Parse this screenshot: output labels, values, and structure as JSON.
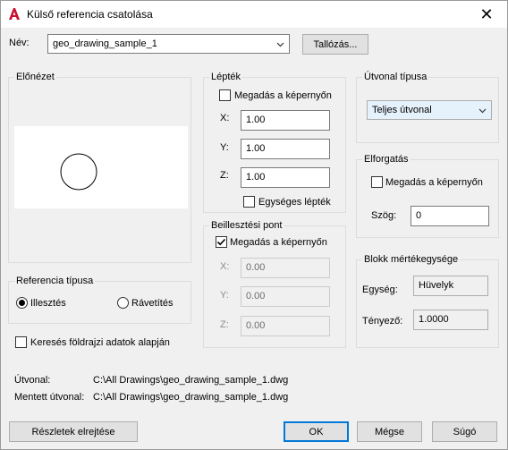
{
  "window": {
    "title": "Külső referencia csatolása",
    "close_symbol": "✕"
  },
  "name_row": {
    "label": "Név:",
    "value": "geo_drawing_sample_1",
    "browse_label": "Tallózás..."
  },
  "preview": {
    "title": "Előnézet"
  },
  "reference_type": {
    "title": "Referencia típusa",
    "options": [
      {
        "label": "Illesztés",
        "selected": true
      },
      {
        "label": "Rávetítés",
        "selected": false
      }
    ]
  },
  "geo_search": {
    "label": "Keresés földrajzi adatok alapján",
    "checked": false
  },
  "scale": {
    "title": "Lépték",
    "on_screen_label": "Megadás a képernyőn",
    "on_screen_checked": false,
    "x_label": "X:",
    "x_value": "1.00",
    "y_label": "Y:",
    "y_value": "1.00",
    "z_label": "Z:",
    "z_value": "1.00",
    "uniform_label": "Egységes lépték",
    "uniform_checked": false
  },
  "insertion": {
    "title": "Beillesztési pont",
    "on_screen_label": "Megadás a képernyőn",
    "on_screen_checked": true,
    "x_label": "X:",
    "x_value": "0.00",
    "y_label": "Y:",
    "y_value": "0.00",
    "z_label": "Z:",
    "z_value": "0.00"
  },
  "path_type": {
    "title": "Útvonal típusa",
    "value": "Teljes útvonal"
  },
  "rotation": {
    "title": "Elforgatás",
    "on_screen_label": "Megadás a képernyőn",
    "on_screen_checked": false,
    "angle_label": "Szög:",
    "angle_value": "0"
  },
  "block_unit": {
    "title": "Blokk mértékegysége",
    "unit_label": "Egység:",
    "unit_value": "Hüvelyk",
    "factor_label": "Tényező:",
    "factor_value": "1.0000"
  },
  "paths": {
    "path_label": "Útvonal:",
    "path_value": "C:\\All Drawings\\geo_drawing_sample_1.dwg",
    "saved_label": "Mentett útvonal:",
    "saved_value": "C:\\All Drawings\\geo_drawing_sample_1.dwg"
  },
  "buttons": {
    "details": "Részletek elrejtése",
    "ok": "OK",
    "cancel": "Mégse",
    "help": "Súgó"
  },
  "colors": {
    "brand_red": "#c8102e",
    "accent": "#0078d7"
  },
  "icons": {
    "app": "autocad-a-icon",
    "close": "close-icon",
    "dropdown": "chevron-down-icon",
    "check": "checkmark-icon"
  }
}
